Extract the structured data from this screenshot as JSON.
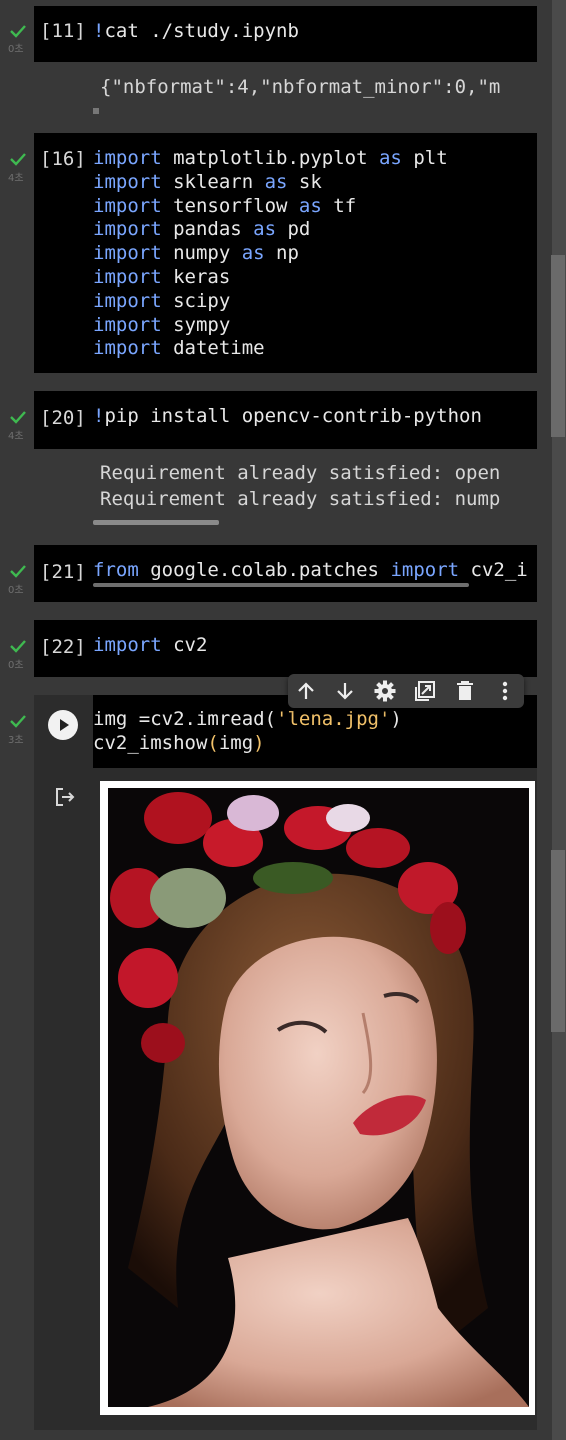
{
  "cells": [
    {
      "id": "c11",
      "prompt": "[11]",
      "time": "0초",
      "code_bang": "!",
      "code": "cat ./study.ipynb",
      "output": [
        "{\"nbformat\":4,\"nbformat_minor\":0,\"m"
      ]
    },
    {
      "id": "c16",
      "prompt": "[16]",
      "time": "4초",
      "lines": [
        {
          "kw1": "import",
          "mod": " matplotlib.pyplot ",
          "kw2": "as",
          "alias": " plt"
        },
        {
          "kw1": "import",
          "mod": " sklearn ",
          "kw2": "as",
          "alias": " sk"
        },
        {
          "kw1": "import",
          "mod": " tensorflow ",
          "kw2": "as",
          "alias": " tf"
        },
        {
          "kw1": "import",
          "mod": " pandas ",
          "kw2": "as",
          "alias": " pd"
        },
        {
          "kw1": "import",
          "mod": " numpy ",
          "kw2": "as",
          "alias": " np"
        },
        {
          "kw1": "import",
          "mod": " keras",
          "kw2": "",
          "alias": ""
        },
        {
          "kw1": "import",
          "mod": " scipy",
          "kw2": "",
          "alias": ""
        },
        {
          "kw1": "import",
          "mod": " sympy",
          "kw2": "",
          "alias": ""
        },
        {
          "kw1": "import",
          "mod": " datetime",
          "kw2": "",
          "alias": ""
        }
      ]
    },
    {
      "id": "c20",
      "prompt": "[20]",
      "time": "4초",
      "code_bang": "!",
      "code": "pip install opencv-contrib-python",
      "output": [
        "Requirement already satisfied: open",
        "Requirement already satisfied: nump"
      ]
    },
    {
      "id": "c21",
      "prompt": "[21]",
      "time": "0초",
      "kw1": "from",
      "mod": " google.colab.patches ",
      "kw2": "import",
      "alias": " cv2_i"
    },
    {
      "id": "c22",
      "prompt": "[22]",
      "time": "0초",
      "kw1": "import",
      "mod": " cv2"
    },
    {
      "id": "c23",
      "time": "3초",
      "line1_pre": "img =cv2.imread(",
      "line1_str": "'lena.jpg'",
      "line1_post": ")",
      "line2_pre": "cv2_imshow",
      "line2_paren_open": "(",
      "line2_arg": "img",
      "line2_paren_close": ")"
    }
  ],
  "toolbar": {
    "items": [
      "move-up-icon",
      "move-down-icon",
      "gear-icon",
      "mirror-cell-icon",
      "delete-icon",
      "more-vert-icon"
    ]
  },
  "output_icon": "output-exit-icon",
  "image": {
    "alt": "lena.jpg"
  },
  "colors": {
    "keyword": "#7aa6ff",
    "string": "#f2c26a",
    "check": "#3fb950",
    "background": "#383838",
    "code_bg": "#000000"
  }
}
